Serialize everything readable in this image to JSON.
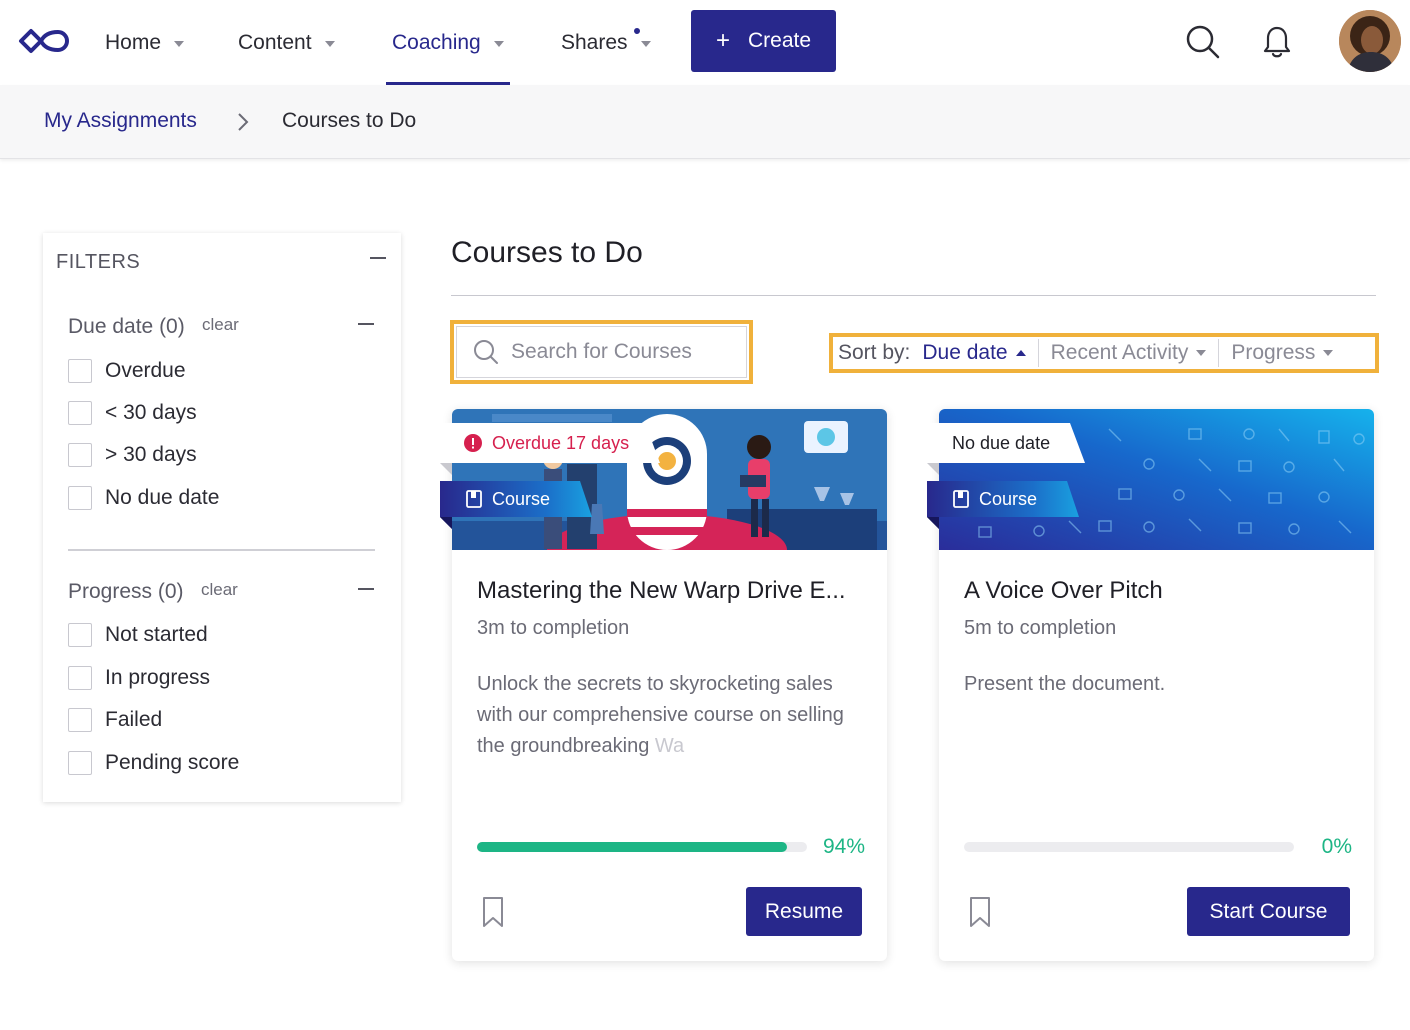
{
  "nav": {
    "home": "Home",
    "content": "Content",
    "coaching": "Coaching",
    "shares": "Shares",
    "create": "Create",
    "create_icon": "plus-icon",
    "search_icon": "search-icon",
    "bell_icon": "bell-icon",
    "logo_icon": "infinity-logo-icon",
    "accent": "#28288c"
  },
  "breadcrumb": {
    "parent": "My Assignments",
    "current": "Courses to Do"
  },
  "filters": {
    "title": "FILTERS",
    "due": {
      "title": "Due date (0)",
      "clear": "clear",
      "options": [
        "Overdue",
        "< 30 days",
        "> 30 days",
        "No due date"
      ]
    },
    "progress": {
      "title": "Progress (0)",
      "clear": "clear",
      "options": [
        "Not started",
        "In progress",
        "Failed",
        "Pending score"
      ]
    }
  },
  "main": {
    "title": "Courses to Do",
    "search_placeholder": "Search for Courses",
    "sort_label": "Sort by:",
    "sort_options": [
      "Due date",
      "Recent Activity",
      "Progress"
    ],
    "highlight": "#f0b13b"
  },
  "cards": [
    {
      "badge": "Overdue 17 days",
      "badge_color": "#d6204e",
      "type": "Course",
      "title": "Mastering the New Warp Drive E...",
      "duration": "3m to completion",
      "description": "Unlock the secrets to skyrocketing sales with our comprehensive course on selling the groundbreaking ",
      "description_fade": "Wa",
      "progress": 94,
      "progress_label": "94%",
      "button": "Resume"
    },
    {
      "badge": "No due date",
      "type": "Course",
      "title": "A Voice Over Pitch",
      "duration": "5m to completion",
      "description": "Present the document.",
      "progress": 0,
      "progress_label": "0%",
      "button": "Start Course"
    }
  ],
  "progress_color": "#1db585"
}
